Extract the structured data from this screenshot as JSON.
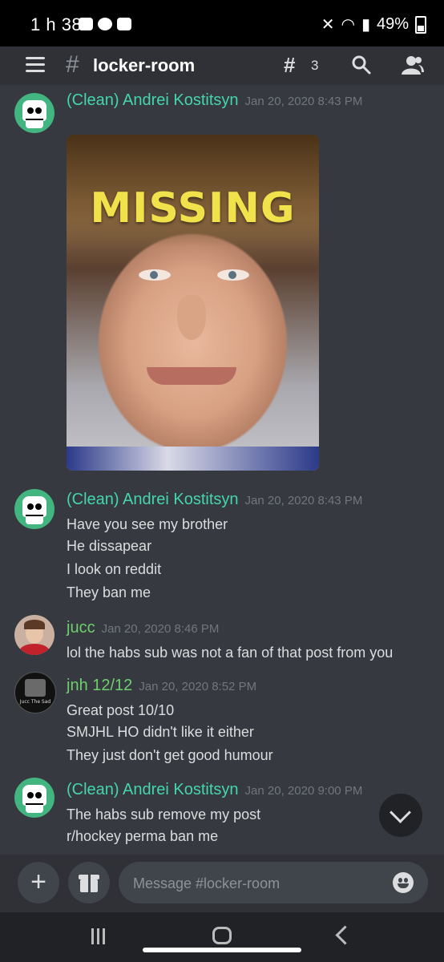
{
  "status_bar": {
    "time": "1 h 38",
    "battery": "49%"
  },
  "header": {
    "channel": "locker-room",
    "hash": "#",
    "threads_count": "3"
  },
  "colors": {
    "bot_name": "#43d6b0",
    "jucc_name": "#6fcf6f",
    "jnh_name": "#6fcf6f",
    "background": "#36393f"
  },
  "messages": [
    {
      "author": "(Clean) Andrei Kostitsyn",
      "timestamp": "Jan 20, 2020 8:43 PM",
      "image_caption": "MISSING",
      "lines": []
    },
    {
      "author": "(Clean) Andrei Kostitsyn",
      "timestamp": "Jan 20, 2020 8:43 PM",
      "lines": [
        "Have you see my brother",
        "He dissapear",
        "I look on reddit",
        "They ban me"
      ]
    },
    {
      "author": "jucc",
      "timestamp": "Jan 20, 2020 8:46 PM",
      "lines": [
        "lol the habs sub was not a fan of that post from you"
      ]
    },
    {
      "author": "jnh 12/12",
      "timestamp": "Jan 20, 2020 8:52 PM",
      "avatar_caption": "Jucc The Sad",
      "lines": [
        "Great post 10/10",
        "SMJHL HO didn't like it either",
        "They just don't get good humour"
      ]
    },
    {
      "author": "(Clean) Andrei Kostitsyn",
      "timestamp": "Jan 20, 2020 9:00 PM",
      "lines": [
        "The habs sub remove my post",
        "r/hockey perma ban me"
      ]
    }
  ],
  "composer": {
    "placeholder": "Message #locker-room",
    "add_label": "+"
  }
}
